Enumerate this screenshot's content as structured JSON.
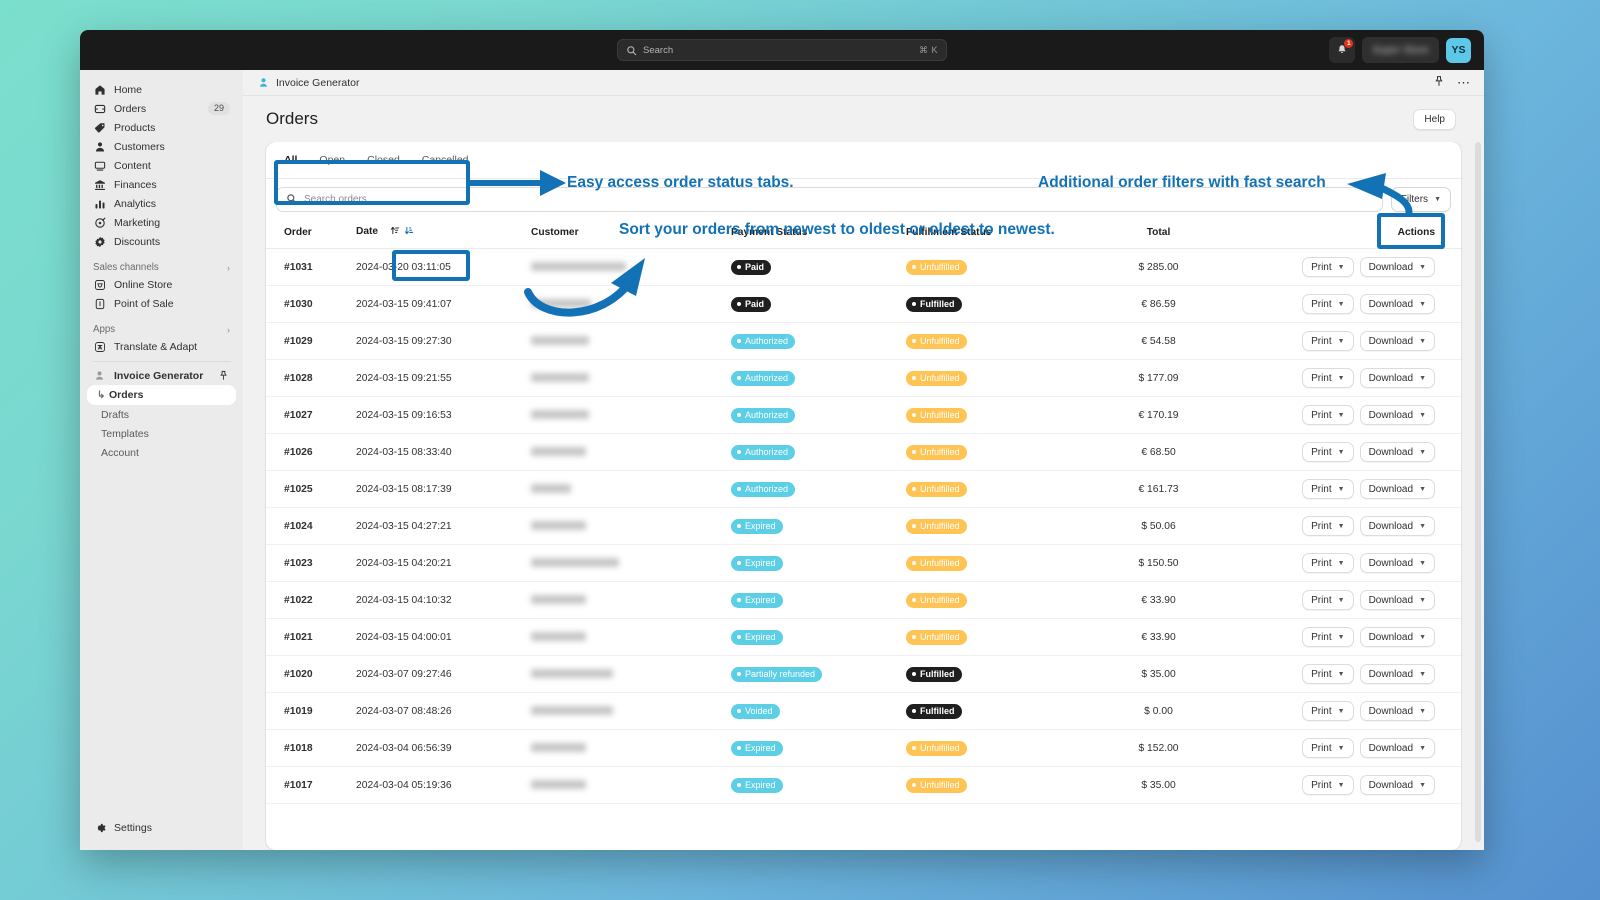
{
  "topbar": {
    "search_placeholder": "Search",
    "search_shortcut": "⌘ K",
    "notification_count": "1",
    "store_name": "Super Store",
    "avatar_initials": "YS"
  },
  "sidebar": {
    "items": [
      {
        "label": "Home",
        "icon": "home-icon",
        "badge": ""
      },
      {
        "label": "Orders",
        "icon": "orders-icon",
        "badge": "29"
      },
      {
        "label": "Products",
        "icon": "products-icon",
        "badge": ""
      },
      {
        "label": "Customers",
        "icon": "customers-icon",
        "badge": ""
      },
      {
        "label": "Content",
        "icon": "content-icon",
        "badge": ""
      },
      {
        "label": "Finances",
        "icon": "finances-icon",
        "badge": ""
      },
      {
        "label": "Analytics",
        "icon": "analytics-icon",
        "badge": ""
      },
      {
        "label": "Marketing",
        "icon": "marketing-icon",
        "badge": ""
      },
      {
        "label": "Discounts",
        "icon": "discounts-icon",
        "badge": ""
      }
    ],
    "sales_channels": {
      "title": "Sales channels",
      "items": [
        {
          "label": "Online Store",
          "icon": "online-store-icon"
        },
        {
          "label": "Point of Sale",
          "icon": "point-of-sale-icon"
        }
      ]
    },
    "apps": {
      "title": "Apps",
      "items": [
        {
          "label": "Translate & Adapt",
          "icon": "translate-adapt-icon"
        }
      ],
      "active_app": "Invoice Generator",
      "sub_items": [
        {
          "label": "Orders",
          "active": true
        },
        {
          "label": "Drafts",
          "active": false
        },
        {
          "label": "Templates",
          "active": false
        },
        {
          "label": "Account",
          "active": false
        }
      ]
    },
    "settings": {
      "label": "Settings",
      "icon": "gear-icon"
    }
  },
  "breadcrumb": {
    "app_name": "Invoice Generator"
  },
  "page": {
    "title": "Orders",
    "help_label": "Help"
  },
  "tabs": [
    {
      "label": "All",
      "active": true
    },
    {
      "label": "Open",
      "active": false
    },
    {
      "label": "Closed",
      "active": false
    },
    {
      "label": "Cancelled",
      "active": false
    }
  ],
  "search": {
    "placeholder": "Search orders"
  },
  "filters_button": {
    "label": "Filters"
  },
  "table": {
    "columns": [
      "Order",
      "Date",
      "Customer",
      "Payment Status",
      "Fulfillment Status",
      "Total",
      "Actions"
    ],
    "sort_column": "Date",
    "actions": {
      "print": "Print",
      "download": "Download"
    },
    "rows": [
      {
        "order": "#1031",
        "date": "2024-03-20 03:11:05",
        "customer_width": 95,
        "payment": "Paid",
        "payment_style": "dark",
        "fulfillment": "Unfulfilled",
        "fulfillment_style": "amber",
        "total": "$ 285.00"
      },
      {
        "order": "#1030",
        "date": "2024-03-15 09:41:07",
        "customer_width": 60,
        "payment": "Paid",
        "payment_style": "dark",
        "fulfillment": "Fulfilled",
        "fulfillment_style": "dark",
        "total": "€ 86.59"
      },
      {
        "order": "#1029",
        "date": "2024-03-15 09:27:30",
        "customer_width": 58,
        "payment": "Authorized",
        "payment_style": "cyan",
        "fulfillment": "Unfulfilled",
        "fulfillment_style": "amber",
        "total": "€ 54.58"
      },
      {
        "order": "#1028",
        "date": "2024-03-15 09:21:55",
        "customer_width": 58,
        "payment": "Authorized",
        "payment_style": "cyan",
        "fulfillment": "Unfulfilled",
        "fulfillment_style": "amber",
        "total": "$ 177.09"
      },
      {
        "order": "#1027",
        "date": "2024-03-15 09:16:53",
        "customer_width": 58,
        "payment": "Authorized",
        "payment_style": "cyan",
        "fulfillment": "Unfulfilled",
        "fulfillment_style": "amber",
        "total": "€ 170.19"
      },
      {
        "order": "#1026",
        "date": "2024-03-15 08:33:40",
        "customer_width": 55,
        "payment": "Authorized",
        "payment_style": "cyan",
        "fulfillment": "Unfulfilled",
        "fulfillment_style": "amber",
        "total": "€ 68.50"
      },
      {
        "order": "#1025",
        "date": "2024-03-15 08:17:39",
        "customer_width": 40,
        "payment": "Authorized",
        "payment_style": "cyan",
        "fulfillment": "Unfulfilled",
        "fulfillment_style": "amber",
        "total": "€ 161.73"
      },
      {
        "order": "#1024",
        "date": "2024-03-15 04:27:21",
        "customer_width": 55,
        "payment": "Expired",
        "payment_style": "cyan",
        "fulfillment": "Unfulfilled",
        "fulfillment_style": "amber",
        "total": "$ 50.06"
      },
      {
        "order": "#1023",
        "date": "2024-03-15 04:20:21",
        "customer_width": 88,
        "payment": "Expired",
        "payment_style": "cyan",
        "fulfillment": "Unfulfilled",
        "fulfillment_style": "amber",
        "total": "$ 150.50"
      },
      {
        "order": "#1022",
        "date": "2024-03-15 04:10:32",
        "customer_width": 55,
        "payment": "Expired",
        "payment_style": "cyan",
        "fulfillment": "Unfulfilled",
        "fulfillment_style": "amber",
        "total": "€ 33.90"
      },
      {
        "order": "#1021",
        "date": "2024-03-15 04:00:01",
        "customer_width": 55,
        "payment": "Expired",
        "payment_style": "cyan",
        "fulfillment": "Unfulfilled",
        "fulfillment_style": "amber",
        "total": "€ 33.90"
      },
      {
        "order": "#1020",
        "date": "2024-03-07 09:27:46",
        "customer_width": 82,
        "payment": "Partially refunded",
        "payment_style": "cyan",
        "fulfillment": "Fulfilled",
        "fulfillment_style": "dark",
        "total": "$ 35.00"
      },
      {
        "order": "#1019",
        "date": "2024-03-07 08:48:26",
        "customer_width": 82,
        "payment": "Voided",
        "payment_style": "cyan",
        "fulfillment": "Fulfilled",
        "fulfillment_style": "dark",
        "total": "$ 0.00"
      },
      {
        "order": "#1018",
        "date": "2024-03-04 06:56:39",
        "customer_width": 55,
        "payment": "Expired",
        "payment_style": "cyan",
        "fulfillment": "Unfulfilled",
        "fulfillment_style": "amber",
        "total": "$ 152.00"
      },
      {
        "order": "#1017",
        "date": "2024-03-04 05:19:36",
        "customer_width": 55,
        "payment": "Expired",
        "payment_style": "cyan",
        "fulfillment": "Unfulfilled",
        "fulfillment_style": "amber",
        "total": "$ 35.00"
      }
    ]
  },
  "annotations": {
    "accent_color": "#1272b5",
    "tabs_note": "Easy access order status tabs.",
    "sort_note": "Sort your orders from newest to oldest or oldest to newest.",
    "filters_note": "Additional order filters with fast search"
  }
}
